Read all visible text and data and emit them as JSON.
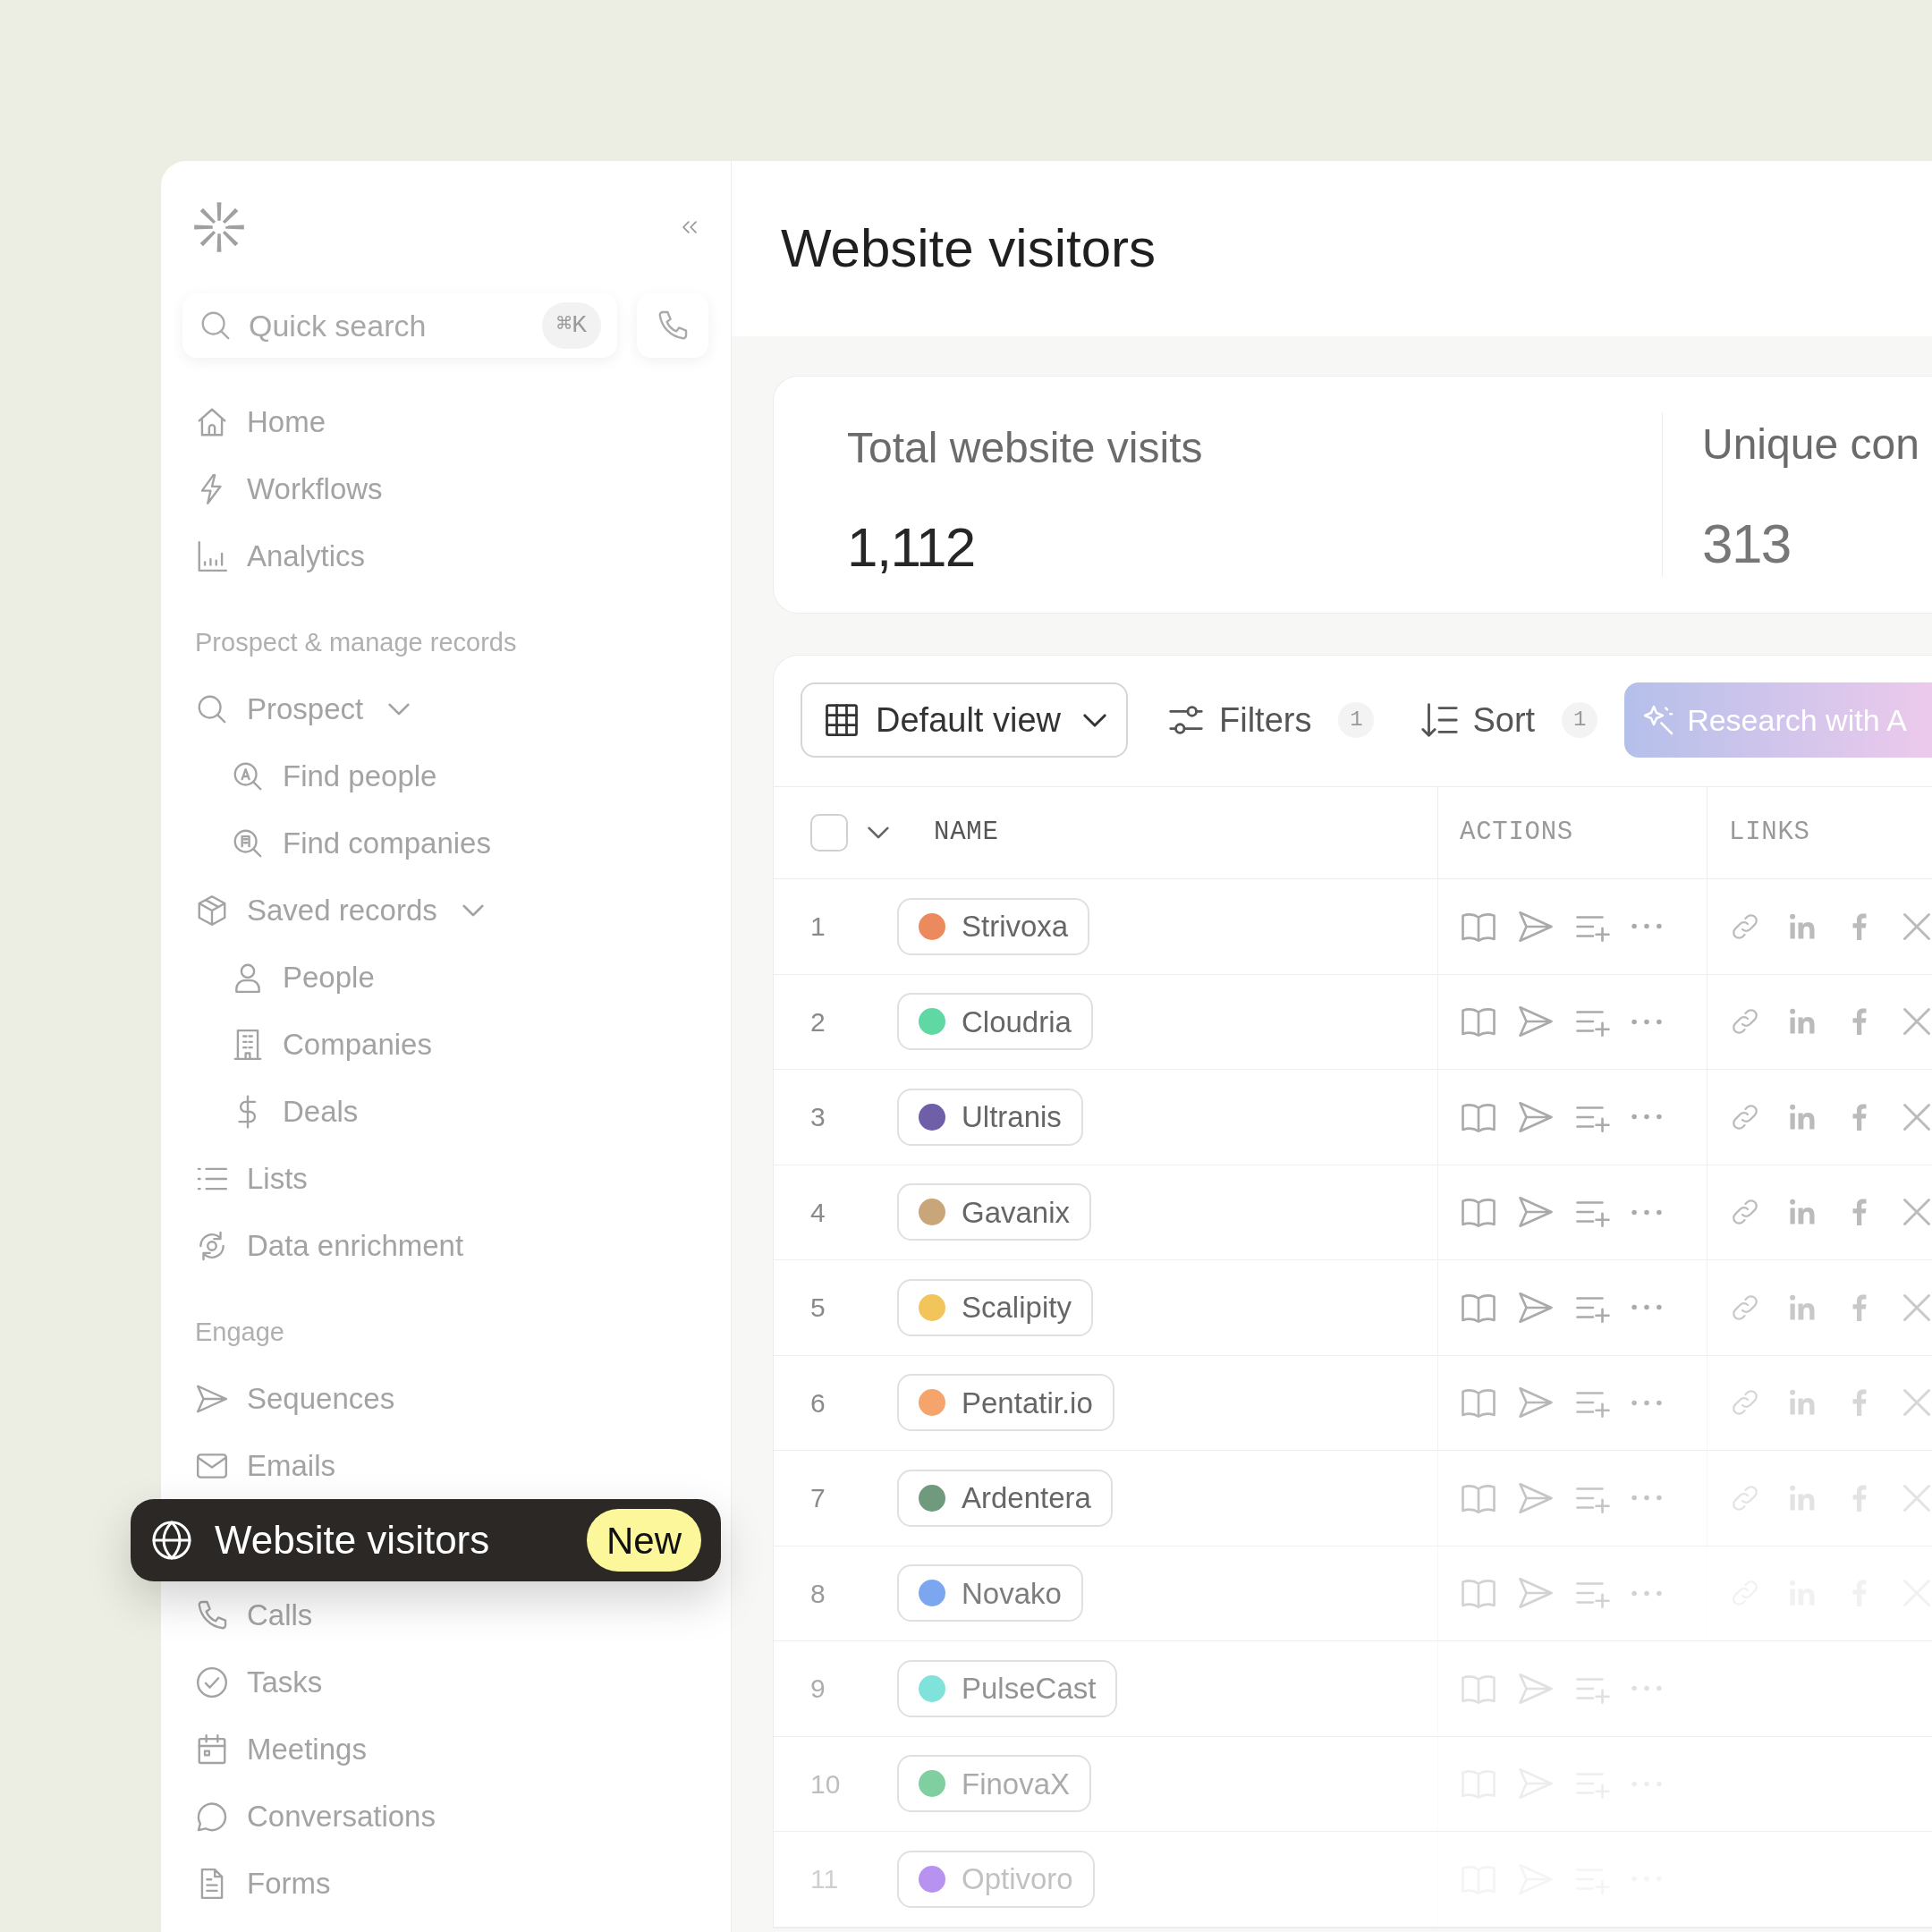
{
  "sidebar": {
    "search": {
      "placeholder": "Quick search",
      "shortcut": "⌘K"
    },
    "sections": [
      {
        "items": [
          {
            "label": "Home",
            "selected": false
          },
          {
            "label": "Workflows",
            "selected": false
          },
          {
            "label": "Analytics",
            "selected": false
          }
        ]
      },
      {
        "heading": "Prospect & manage records",
        "items": [
          {
            "label": "Prospect",
            "selected": false,
            "expanded": true,
            "children": [
              {
                "label": "Find people",
                "selected": false
              },
              {
                "label": "Find companies",
                "selected": false
              }
            ]
          },
          {
            "label": "Saved records",
            "selected": false,
            "expanded": true,
            "children": [
              {
                "label": "People",
                "selected": false
              },
              {
                "label": "Companies",
                "selected": false
              },
              {
                "label": "Deals",
                "selected": false
              }
            ]
          },
          {
            "label": "Lists",
            "selected": false
          },
          {
            "label": "Data enrichment",
            "selected": false
          }
        ]
      },
      {
        "heading": "Engage",
        "items": [
          {
            "label": "Sequences",
            "selected": false
          },
          {
            "label": "Emails",
            "selected": false
          },
          {
            "label": "Website visitors",
            "selected": true,
            "badge": "New"
          },
          {
            "label": "Calls",
            "selected": false
          },
          {
            "label": "Tasks",
            "selected": false
          },
          {
            "label": "Meetings",
            "selected": false
          },
          {
            "label": "Conversations",
            "selected": false
          },
          {
            "label": "Forms",
            "selected": false
          }
        ]
      }
    ]
  },
  "main": {
    "title": "Website visitors",
    "stats": [
      {
        "label": "Total website visits",
        "value": "1,112"
      },
      {
        "label": "Unique con",
        "value": "313"
      }
    ],
    "toolbar": {
      "view": "Default view",
      "filters": {
        "label": "Filters",
        "count": "1"
      },
      "sort": {
        "label": "Sort",
        "count": "1"
      },
      "research": "Research with A"
    },
    "table": {
      "select_all_checked": false,
      "columns": [
        "NAME",
        "ACTIONS",
        "LINKS"
      ],
      "rows": [
        {
          "number": "1",
          "name": "Strivoxa",
          "color": "#ec8a5e"
        },
        {
          "number": "2",
          "name": "Cloudria",
          "color": "#5fd8a4"
        },
        {
          "number": "3",
          "name": "Ultranis",
          "color": "#6f5fa8"
        },
        {
          "number": "4",
          "name": "Gavanix",
          "color": "#c9a57a"
        },
        {
          "number": "5",
          "name": "Scalipity",
          "color": "#f2c55a"
        },
        {
          "number": "6",
          "name": "Pentatir.io",
          "color": "#f5a46c"
        },
        {
          "number": "7",
          "name": "Ardentera",
          "color": "#6f9a7e"
        },
        {
          "number": "8",
          "name": "Novako",
          "color": "#7ca7f0"
        },
        {
          "number": "9",
          "name": "PulseCast",
          "color": "#7fe3dc"
        },
        {
          "number": "10",
          "name": "FinovaX",
          "color": "#7fcfa0"
        },
        {
          "number": "11",
          "name": "Optivoro",
          "color": "#b892f0"
        }
      ]
    }
  }
}
